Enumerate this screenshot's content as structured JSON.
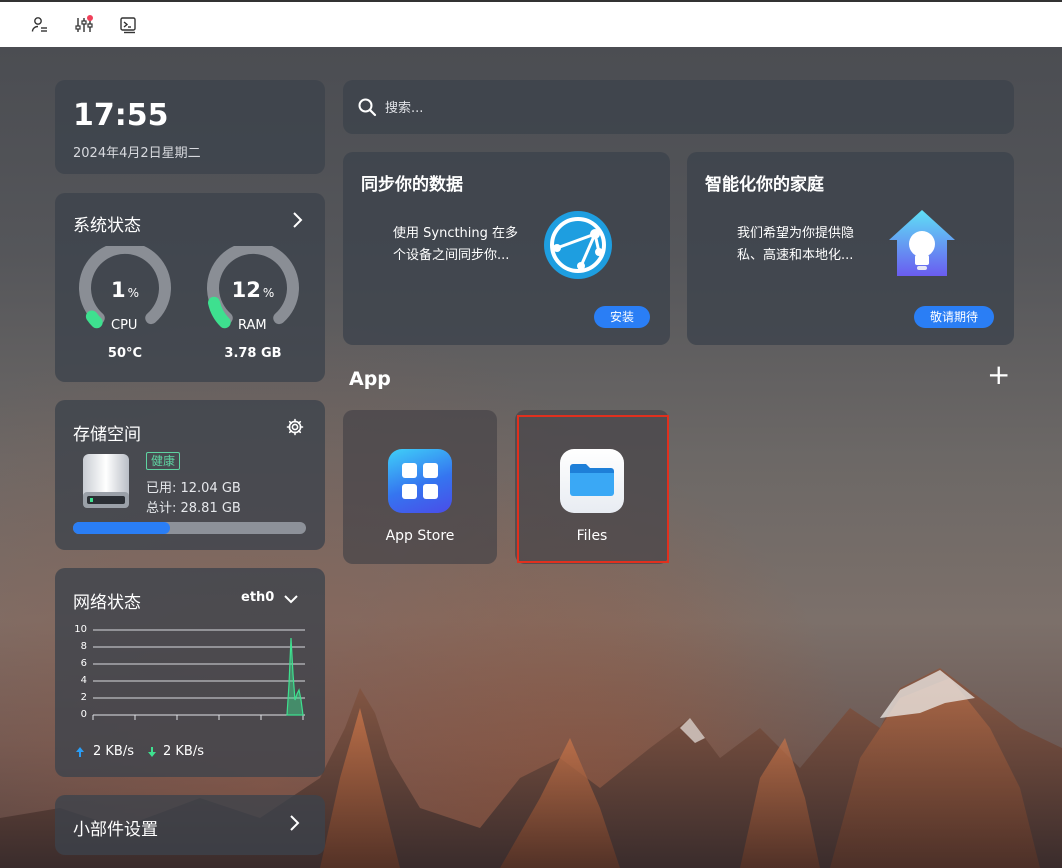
{
  "toolbar": {
    "icons": [
      "user-list-icon",
      "sliders-icon",
      "terminal-icon"
    ],
    "notification_dot_color": "#f0405a"
  },
  "clock": {
    "time": "17:55",
    "date": "2024年4月2日星期二"
  },
  "system_status": {
    "title": "系统状态",
    "cpu": {
      "value": "1",
      "unit": "%",
      "label": "CPU",
      "sub": "50°C",
      "fraction": 0.01
    },
    "ram": {
      "value": "12",
      "unit": "%",
      "label": "RAM",
      "sub": "3.78 GB",
      "fraction": 0.12
    }
  },
  "storage": {
    "title": "存储空间",
    "badge": "健康",
    "used": "已用: 12.04 GB",
    "total": "总计: 28.81 GB",
    "used_fraction": 0.418
  },
  "network": {
    "title": "网络状态",
    "interface": "eth0",
    "y_ticks": [
      "10",
      "8",
      "6",
      "4",
      "2",
      "0"
    ],
    "upload": "2 KB/s",
    "download": "2 KB/s"
  },
  "widget_settings": {
    "title": "小部件设置"
  },
  "search": {
    "placeholder": "搜索..."
  },
  "promos": [
    {
      "title": "同步你的数据",
      "text": "使用 Syncthing 在多个设备之间同步你...",
      "button": "安装"
    },
    {
      "title": "智能化你的家庭",
      "text": "我们希望为你提供隐私、高速和本地化...",
      "button": "敬请期待"
    }
  ],
  "apps": {
    "section_title": "App",
    "add_symbol": "+",
    "items": [
      {
        "label": "App Store",
        "icon": "app-store-icon"
      },
      {
        "label": "Files",
        "icon": "folder-icon",
        "highlighted": true
      }
    ]
  },
  "colors": {
    "accent": "#2a7ef5",
    "healthy": "#5fd3a1",
    "gauge_fill": "#3ee08f",
    "highlight_border": "#e0301e"
  }
}
